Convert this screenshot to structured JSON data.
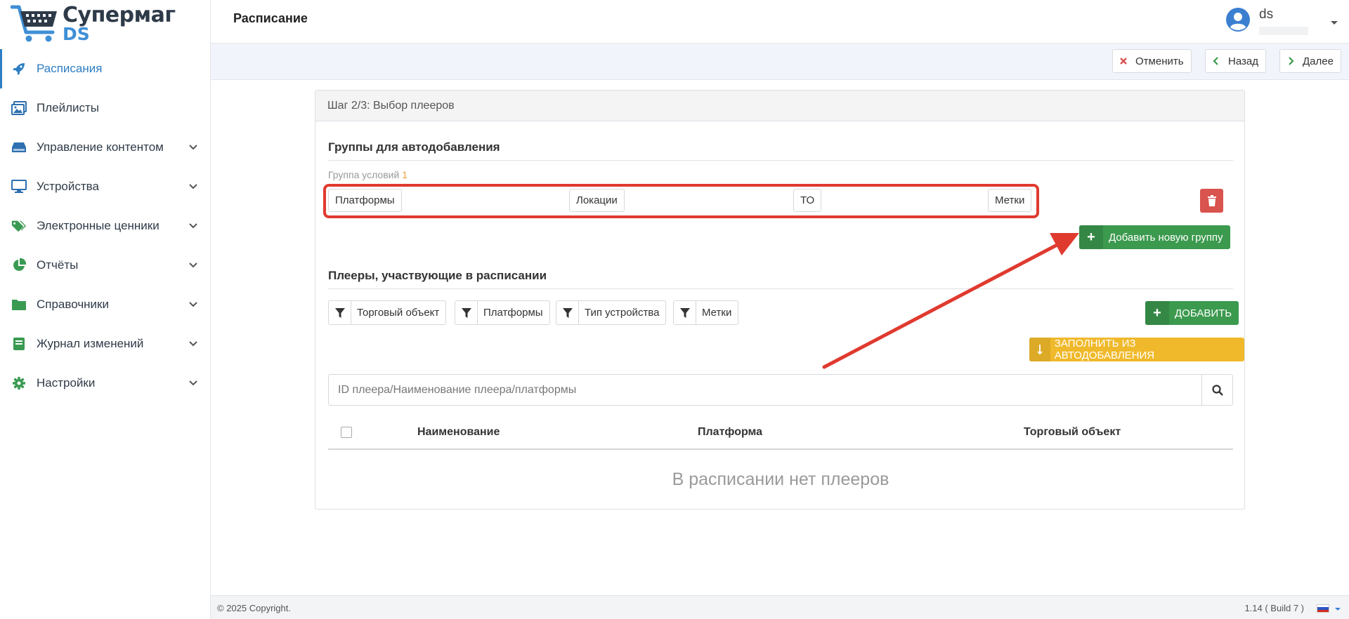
{
  "app": {
    "logo_line1": "Супермаг",
    "logo_line2": "DS"
  },
  "sidebar": {
    "items": [
      {
        "label": "Расписания",
        "icon": "rocket-icon",
        "active": true
      },
      {
        "label": "Плейлисты",
        "icon": "images-icon"
      },
      {
        "label": "Управление контентом",
        "icon": "hdd-icon"
      },
      {
        "label": "Устройства",
        "icon": "monitor-icon"
      },
      {
        "label": "Электронные ценники",
        "icon": "tags-icon"
      },
      {
        "label": "Отчёты",
        "icon": "pie-chart-icon"
      },
      {
        "label": "Справочники",
        "icon": "folder-icon"
      },
      {
        "label": "Журнал изменений",
        "icon": "book-icon"
      },
      {
        "label": "Настройки",
        "icon": "gear-icon"
      }
    ]
  },
  "header": {
    "title": "Расписание",
    "user_name": "ds"
  },
  "actions": {
    "cancel": "Отменить",
    "back": "Назад",
    "next": "Далее"
  },
  "wizard": {
    "step_title": "Шаг 2/3: Выбор плееров",
    "autoadd": {
      "title": "Группы для автодобавления",
      "group_label": "Группа условий",
      "group_number": "1",
      "tags": [
        "Платформы",
        "Локации",
        "ТО",
        "Метки"
      ],
      "add_group_button": "Добавить новую группу"
    },
    "players": {
      "title": "Плееры, участвующие в расписании",
      "filters": [
        "Торговый объект",
        "Платформы",
        "Тип устройства",
        "Метки"
      ],
      "add_button": "ДОБАВИТЬ",
      "fill_button": "ЗАПОЛНИТЬ ИЗ АВТОДОБАВЛЕНИЯ",
      "search_placeholder": "ID плеера/Наименование плеера/платформы",
      "columns": [
        "Наименование",
        "Платформа",
        "Торговый объект"
      ],
      "empty_text": "В расписании нет плееров"
    }
  },
  "footer": {
    "copyright": "© 2025 Copyright.",
    "version": "1.14 ( Build 7 )"
  },
  "colors": {
    "accent": "#2d7ec4",
    "green": "#3c9a4e",
    "yellow": "#f0b92b",
    "danger": "#d9534f",
    "annotation_red": "#e03a2f"
  }
}
